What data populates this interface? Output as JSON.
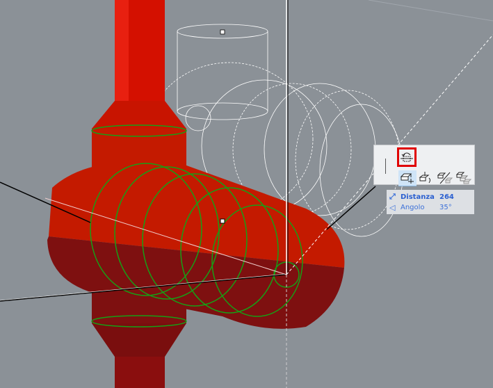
{
  "viewport": {
    "colors": {
      "background": "#8b9197",
      "solid_body": "#c41a00",
      "shadow_body": "#7e1010",
      "highlight_edges": "#16a016",
      "ghost_lines": "#ffffff"
    }
  },
  "toolbar": {
    "buttons": [
      {
        "name": "rotate",
        "icon": "rotate-icon",
        "highlighted": true
      },
      {
        "name": "move",
        "icon": "move-icon",
        "active": true
      },
      {
        "name": "rotate-copy",
        "icon": "rotate-copy-icon"
      },
      {
        "name": "mirror",
        "icon": "mirror-icon"
      },
      {
        "name": "multiply",
        "icon": "multiply-icon"
      }
    ]
  },
  "infobox": {
    "distance_label": "Distanza",
    "distance_value": "264",
    "angle_label": "Angolo",
    "angle_value": "35°"
  }
}
